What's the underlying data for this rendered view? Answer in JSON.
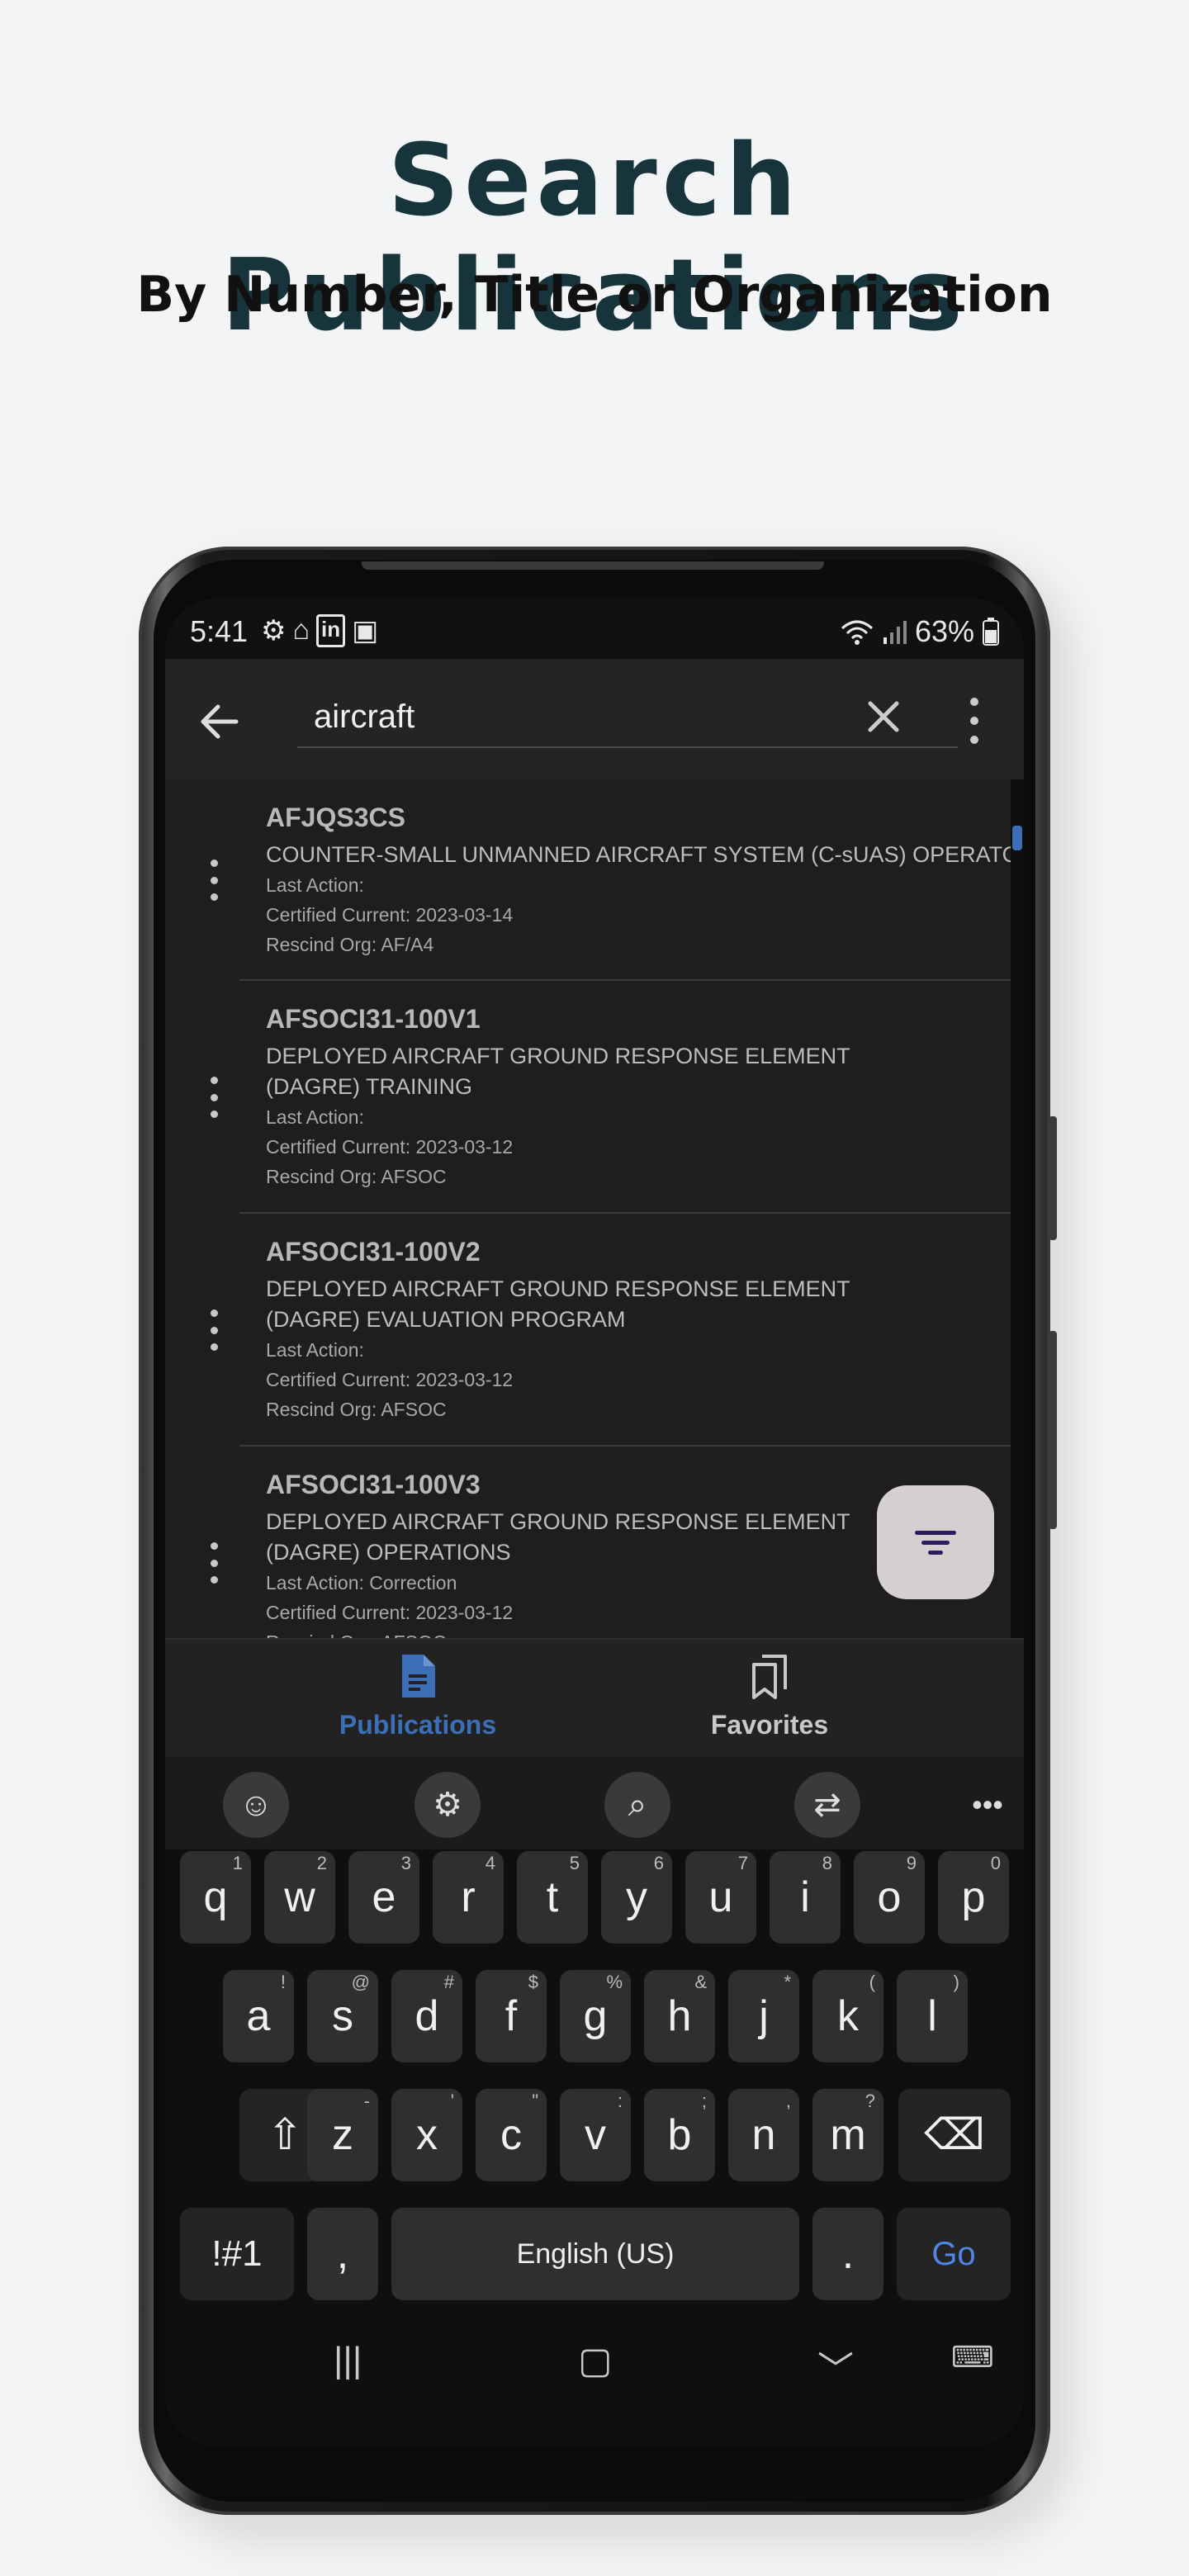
{
  "headline": "Search Publications",
  "subheadline": "By Number, Title or Organization",
  "status_bar": {
    "time": "5:41",
    "battery": "63%"
  },
  "search": {
    "value": "aircraft"
  },
  "results": [
    {
      "number": "AFJQS3CS",
      "title": "COUNTER-SMALL UNMANNED AIRCRAFT SYSTEM (C-sUAS) OPERATOR",
      "last_action": "Last Action:",
      "certified": "Certified Current: 2023-03-14",
      "rescind": "Rescind Org: AF/A4"
    },
    {
      "number": "AFSOCI31-100V1",
      "title": "DEPLOYED AIRCRAFT GROUND RESPONSE ELEMENT (DAGRE) TRAINING",
      "last_action": "Last Action:",
      "certified": "Certified Current: 2023-03-12",
      "rescind": "Rescind Org: AFSOC"
    },
    {
      "number": "AFSOCI31-100V2",
      "title": "DEPLOYED AIRCRAFT GROUND RESPONSE ELEMENT (DAGRE) EVALUATION PROGRAM",
      "last_action": "Last Action:",
      "certified": "Certified Current: 2023-03-12",
      "rescind": "Rescind Org: AFSOC"
    },
    {
      "number": "AFSOCI31-100V3",
      "title": "DEPLOYED AIRCRAFT GROUND RESPONSE ELEMENT (DAGRE) OPERATIONS",
      "last_action": "Last Action: Correction",
      "certified": "Certified Current: 2023-03-12",
      "rescind": "Rescind Org: AFSOC"
    }
  ],
  "bottom_nav": {
    "publications": "Publications",
    "favorites": "Favorites"
  },
  "colors": {
    "accent": "#3d6fb8",
    "headline": "#17343c",
    "fab": "#d6cfd0"
  },
  "keyboard": {
    "row1": [
      "q",
      "w",
      "e",
      "r",
      "t",
      "y",
      "u",
      "i",
      "o",
      "p"
    ],
    "row1_sup": [
      "1",
      "2",
      "3",
      "4",
      "5",
      "6",
      "7",
      "8",
      "9",
      "0"
    ],
    "row2": [
      "a",
      "s",
      "d",
      "f",
      "g",
      "h",
      "j",
      "k",
      "l"
    ],
    "row2_sup": [
      "!",
      "@",
      "#",
      "$",
      "%",
      "&",
      "*",
      "(",
      ")"
    ],
    "row3": [
      "z",
      "x",
      "c",
      "v",
      "b",
      "n",
      "m"
    ],
    "row3_sup": [
      "-",
      "'",
      "\"",
      ":",
      ";",
      ",",
      "?"
    ],
    "symbols": "!#1",
    "comma": ",",
    "space": "English (US)",
    "period": ".",
    "go": "Go"
  }
}
